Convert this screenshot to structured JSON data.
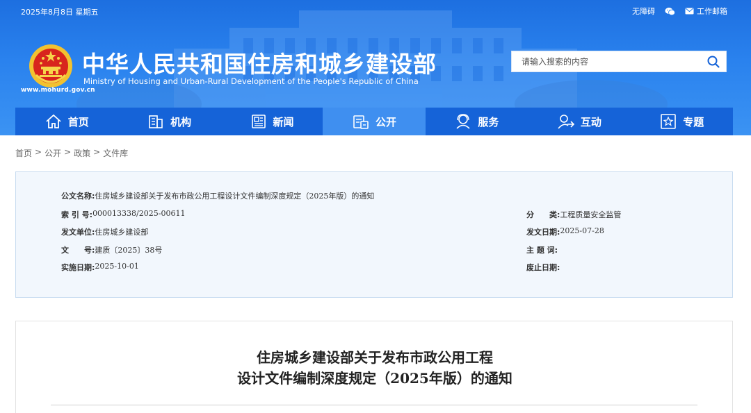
{
  "topbar": {
    "date": "2025年8月8日 星期五",
    "accessibility": "无障碍",
    "wechat_icon": "wechat-icon",
    "mail_icon": "mail-icon",
    "mail": "工作邮箱"
  },
  "site": {
    "title_cn": "中华人民共和国住房和城乡建设部",
    "title_en": "Ministry of Housing and Urban-Rural Development of the People's Republic of China",
    "url": "www.mohurd.gov.cn"
  },
  "search": {
    "placeholder": "请输入搜索的内容"
  },
  "nav": {
    "items": [
      {
        "label": "首页",
        "icon": "home-icon"
      },
      {
        "label": "机构",
        "icon": "building-icon"
      },
      {
        "label": "新闻",
        "icon": "news-icon"
      },
      {
        "label": "公开",
        "icon": "disclosure-icon",
        "active": true
      },
      {
        "label": "服务",
        "icon": "service-icon"
      },
      {
        "label": "互动",
        "icon": "interaction-icon"
      },
      {
        "label": "专题",
        "icon": "topic-icon"
      }
    ]
  },
  "breadcrumb": {
    "items": [
      "首页",
      "公开",
      "政策",
      "文件库"
    ],
    "separator": ">"
  },
  "info": {
    "doc_name_label": "公文名称:",
    "doc_name": "住房城乡建设部关于发布市政公用工程设计文件编制深度规定（2025年版）的通知",
    "index_label": "索 引 号:",
    "index": "000013338/2025-00611",
    "category_label": "分　　类:",
    "category": "工程质量安全监管",
    "issuer_label": "发文单位:",
    "issuer": "住房城乡建设部",
    "issue_date_label": "发文日期:",
    "issue_date": "2025-07-28",
    "doc_no_label": "文　　号:",
    "doc_no": "建质〔2025〕38号",
    "keywords_label": "主 题 词:",
    "keywords": "",
    "effective_label": "实施日期:",
    "effective": "2025-10-01",
    "abolish_label": "废止日期:",
    "abolish": ""
  },
  "document": {
    "title_line1": "住房城乡建设部关于发布市政公用工程",
    "title_line2": "设计文件编制深度规定（2025年版）的通知"
  },
  "colors": {
    "header_blue": "#2a82ee",
    "nav_blue": "#1563d8",
    "nav_active": "#3f8ff0",
    "panel_bg": "#f2f7fd"
  }
}
